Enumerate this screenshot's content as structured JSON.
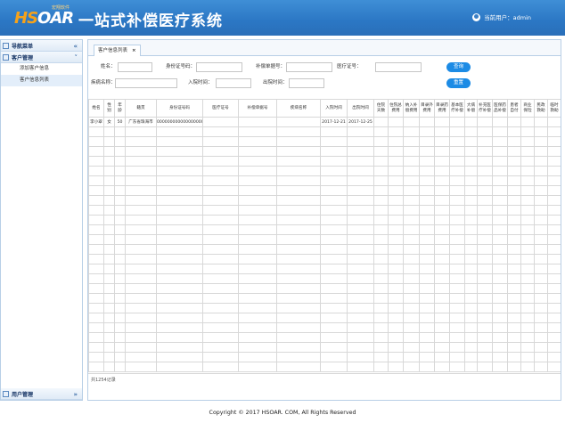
{
  "header": {
    "logo_text_hs": "HS",
    "logo_text_rest": "OAR",
    "logo_sub": "宏翔软件",
    "title": "一站式补偿医疗系统",
    "current_user_label": "当前用户：admin"
  },
  "sidebar": {
    "nav_title": "导航菜单",
    "sections": [
      {
        "label": "客户管理",
        "items": [
          "添加客户信息",
          "客户信息列表"
        ]
      },
      {
        "label": "用户管理",
        "items": []
      }
    ]
  },
  "tab": {
    "label": "客户信息列表",
    "close": "×"
  },
  "filters": {
    "name_label": "姓名：",
    "idcard_label": "身份证号码：",
    "claim_no_label": "补偿单据号：",
    "medical_no_label": "医疗证号：",
    "disease_label": "疾病名称：",
    "admit_label": "入院时间：",
    "discharge_label": "出院时间：",
    "query_button": "查询",
    "reset_button": "重置"
  },
  "table": {
    "columns": [
      "姓名",
      "性别",
      "年龄",
      "籍贯",
      "身份证号码",
      "医疗证号",
      "补偿单据号",
      "疾病名称",
      "入院时间",
      "出院时间",
      "住院天数",
      "住院总费用",
      "纳入补偿费用",
      "目录外费用",
      "目录药费用",
      "基本医疗补偿",
      "大病补偿",
      "补充医疗补偿",
      "医保药品补偿",
      "患者自付",
      "商业保险",
      "民政救助",
      "临时救助",
      "个人自付",
      "个人自付比例",
      "备注"
    ],
    "rows": [
      [
        "李小翠",
        "女",
        "50",
        "广东省珠海市",
        "000000000000000000",
        "",
        "",
        "",
        "2017-12-21",
        "2017-12-25",
        "",
        "",
        "",
        "",
        "",
        "",
        "",
        "",
        "",
        "",
        "",
        "",
        "",
        "",
        "",
        ""
      ]
    ],
    "empty_rows": 25,
    "footer_text": "共1254记录"
  },
  "footer": {
    "copyright": "Copyright © 2017 HSOAR. COM, All Rights Reserved"
  },
  "colors": {
    "header_blue": "#2b77c4",
    "button_blue": "#1c8be5",
    "logo_orange": "#f5a21b"
  }
}
